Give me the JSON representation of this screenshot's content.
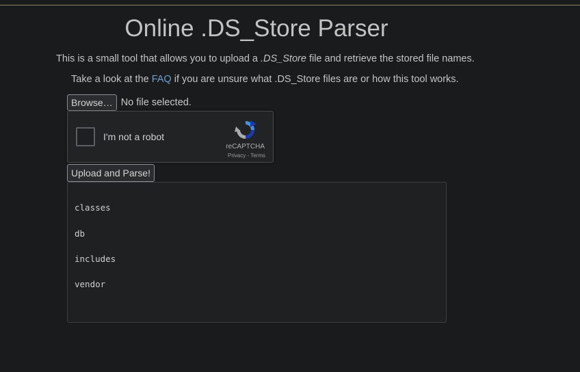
{
  "title": "Online .DS_Store Parser",
  "intro": {
    "before": "This is a small tool that allows you to upload a ",
    "em": ".DS_Store",
    "after": " file and retrieve the stored file names."
  },
  "faq": {
    "before": "Take a look at the ",
    "link": "FAQ",
    "after": " if you are unsure what .DS_Store files are or how this tool works."
  },
  "file_input": {
    "button_label": "Browse…",
    "status": "No file selected."
  },
  "captcha": {
    "label": "I'm not a robot",
    "brand": "reCAPTCHA",
    "privacy": "Privacy",
    "separator": " - ",
    "terms": "Terms"
  },
  "upload_label": "Upload and Parse!",
  "results": [
    "classes",
    "db",
    "includes",
    "vendor"
  ],
  "colors": {
    "background": "#1a1b1c",
    "link": "#6f9fd0",
    "accent_line": "#8a8466"
  }
}
